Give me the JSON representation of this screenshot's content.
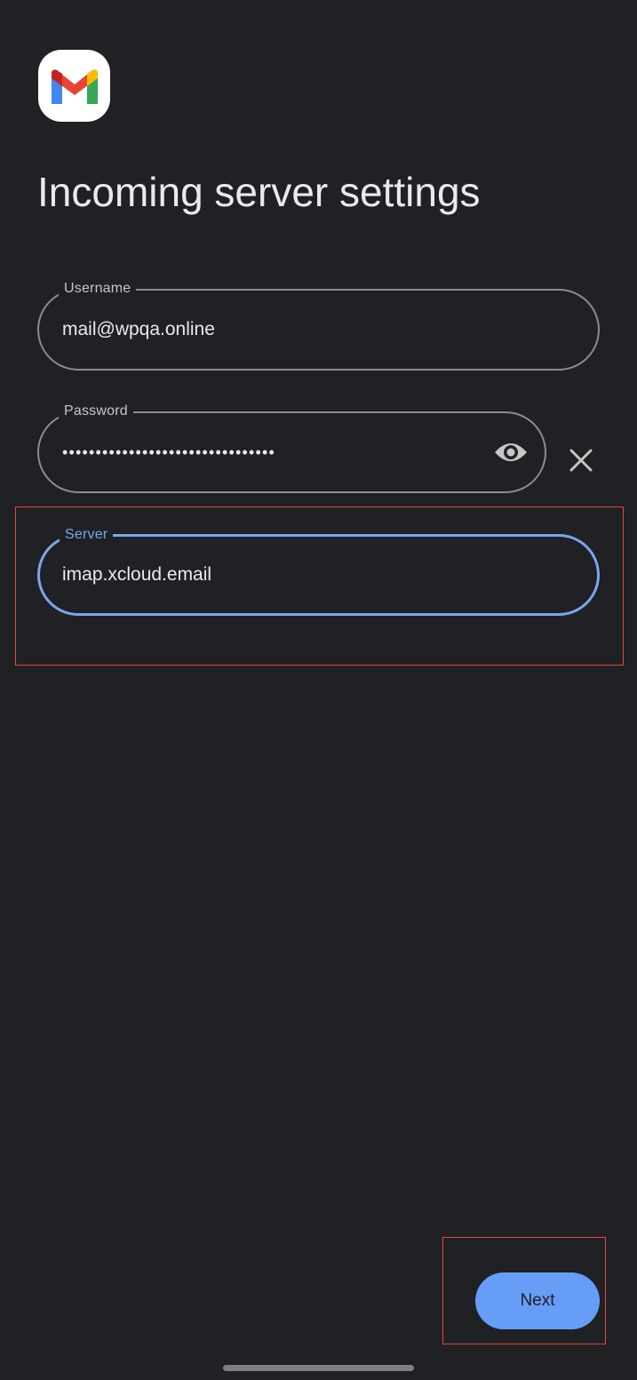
{
  "title": "Incoming server settings",
  "app_logo": "gmail-logo",
  "fields": {
    "username": {
      "label": "Username",
      "value": "mail@wpqa.online"
    },
    "password": {
      "label": "Password",
      "value": "••••••••••••••••••••••••••••••••",
      "toggle_icon": "eye-icon",
      "clear_icon": "close-icon"
    },
    "server": {
      "label": "Server",
      "value": "imap.xcloud.email"
    }
  },
  "actions": {
    "next_label": "Next"
  },
  "colors": {
    "background": "#202124",
    "accent": "#669df6",
    "focused_border": "#7aa7f0",
    "highlight": "#e5483c"
  }
}
